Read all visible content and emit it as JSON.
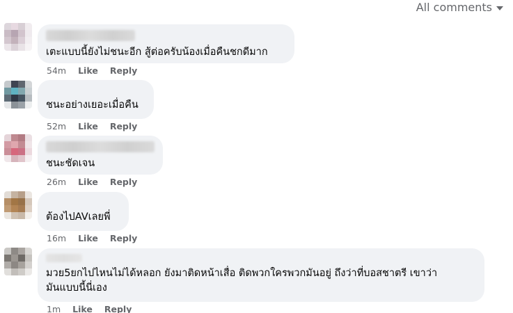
{
  "filter": {
    "label": "All comments",
    "icon": "caret-down-icon"
  },
  "comments": [
    {
      "text": "เตะแบบนี้ยังไม่ชนะอีก สู้ต่อครับน้องเมื่อคืนชกดีมาก",
      "time": "54m",
      "like": "Like",
      "reply": "Reply",
      "avatar_colors": [
        "#ded6dc",
        "#e8d9e2",
        "#d9cfd5",
        "#f1ecef",
        "#cbbcc6",
        "#b9a4b3",
        "#d3c4ce",
        "#efeaee",
        "#d5c7cf",
        "#c4b2bc",
        "#dccfd7",
        "#f2eef1",
        "#ece6ea",
        "#dcd2d8",
        "#eae3e7",
        "#f6f3f5"
      ]
    },
    {
      "text": "ชนะอย่างเยอะเมื่อคืน",
      "time": "52m",
      "like": "Like",
      "reply": "Reply",
      "avatar_colors": [
        "#c5c9cc",
        "#3e4452",
        "#5f6670",
        "#d4d6d8",
        "#6d9aa3",
        "#58b4c4",
        "#7fa8b0",
        "#c9cfd2",
        "#5d6b78",
        "#2f3846",
        "#455463",
        "#b7bcc1",
        "#e5e7e9",
        "#8a9299",
        "#9aa2a9",
        "#eceeef"
      ]
    },
    {
      "text": "ชนะชัดเจน",
      "time": "26m",
      "like": "Like",
      "reply": "Reply",
      "avatar_colors": [
        "#e6d4d9",
        "#c4888f",
        "#b77a83",
        "#ecdfe3",
        "#d89aa4",
        "#e4a6ad",
        "#c88a92",
        "#f1e5e8",
        "#cf8d98",
        "#e0647c",
        "#d36e84",
        "#eed9de",
        "#f1e7ea",
        "#d9b3bb",
        "#e3c4cb",
        "#f6eff1"
      ]
    },
    {
      "text": "ต้องไปAVเลยพี่",
      "time": "16m",
      "like": "Like",
      "reply": "Reply",
      "avatar_colors": [
        "#e3dcd5",
        "#c7b39f",
        "#b99f86",
        "#ece6e0",
        "#b98d61",
        "#a6753f",
        "#9b7044",
        "#d6c7b8",
        "#c49a6f",
        "#b7844f",
        "#a97a4d",
        "#ded0c2",
        "#ece6df",
        "#d1c2b1",
        "#cbb9a7",
        "#f3efea"
      ]
    },
    {
      "text": "มวย5ยกไปไหนไม่ได้หลอก ยังมาติดหน้าเสื่อ ติดพวกใครพวกมันอยู่ ถึงว่าที่บอสชาตรี เขาว่า\nมันแบบนี้นี่เอง",
      "time": "1m",
      "like": "Like",
      "reply": "Reply",
      "avatar_colors": [
        "#c9c7c4",
        "#8e8a86",
        "#a9a4a0",
        "#d8d6d3",
        "#7a7670",
        "#9b9690",
        "#6e6a66",
        "#c6c3bf",
        "#b0aca7",
        "#8d8883",
        "#a7a29c",
        "#d4d1ce",
        "#e1dfdc",
        "#c2beba",
        "#cfccc8",
        "#ebe9e7"
      ]
    }
  ]
}
